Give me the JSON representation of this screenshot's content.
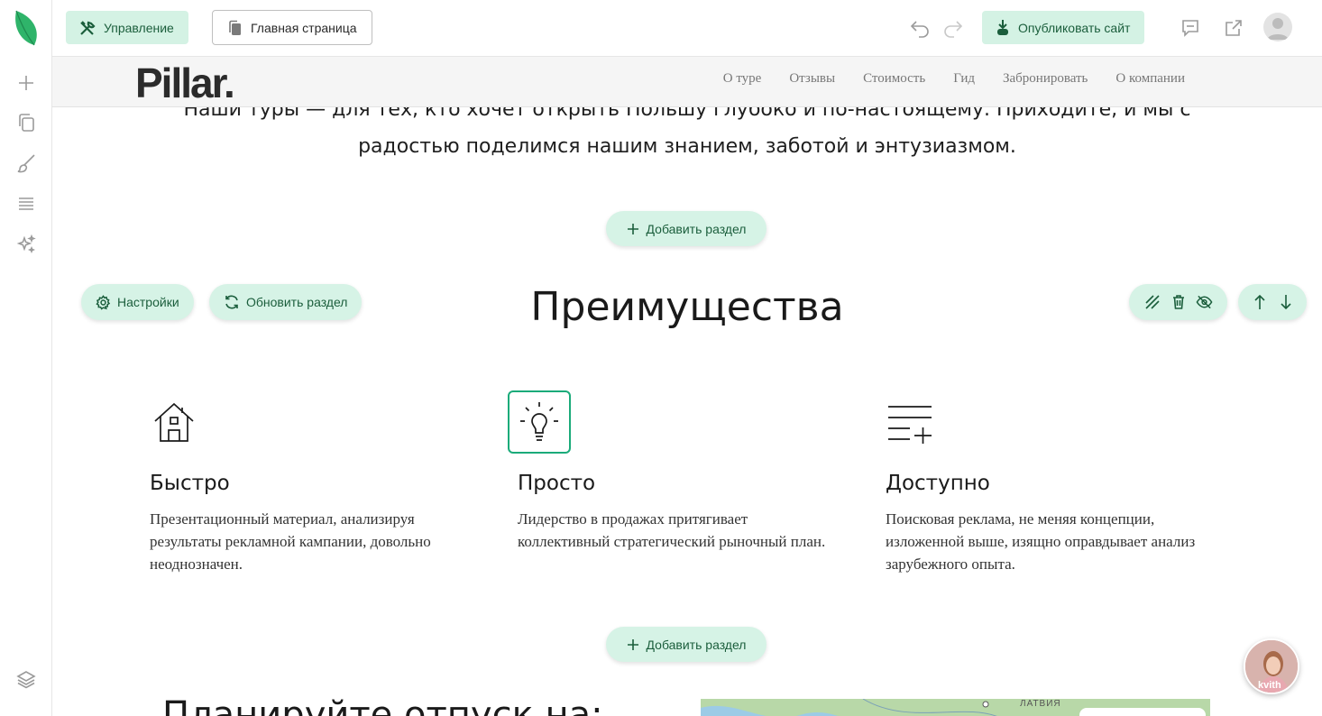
{
  "topbar": {
    "manage_label": "Управление",
    "page_label": "Главная страница",
    "publish_label": "Опубликовать сайт"
  },
  "site": {
    "logo": "Pillar.",
    "nav": [
      "О туре",
      "Отзывы",
      "Стоимость",
      "Гид",
      "Забронировать",
      "О компании"
    ]
  },
  "content": {
    "intro_line1": "Наши туры — для тех, кто хочет открыть Польшу глубоко и по-настоящему. Приходите, и мы с",
    "intro_line2": "радостью поделимся нашим знанием, заботой и энтузиазмом.",
    "add_section_label": "Добавить раздел",
    "settings_label": "Настройки",
    "refresh_label": "Обновить раздел",
    "section_title": "Преимущества",
    "features": [
      {
        "icon": "house-icon",
        "title": "Быстро",
        "text": "Презентационный материал, анализируя результаты рекламной кампании, довольно неоднозначен."
      },
      {
        "icon": "lightbulb-icon",
        "title": "Просто",
        "text": "Лидерство в продажах притягивает коллективный стратегический рыночный план."
      },
      {
        "icon": "list-add-icon",
        "title": "Доступно",
        "text": "Поисковая реклама, не меняя концепции, изложенной выше, изящно оправдывает анализ зарубежного опыта."
      }
    ],
    "next_heading": "Планируйте отпуск на:",
    "map_label": "ЛАТВИЯ"
  },
  "chat": {
    "label": "kvith"
  },
  "colors": {
    "accent": "#d4f2e4",
    "accent_text": "#1b5e3c",
    "selected_border": "#1bab7a"
  }
}
